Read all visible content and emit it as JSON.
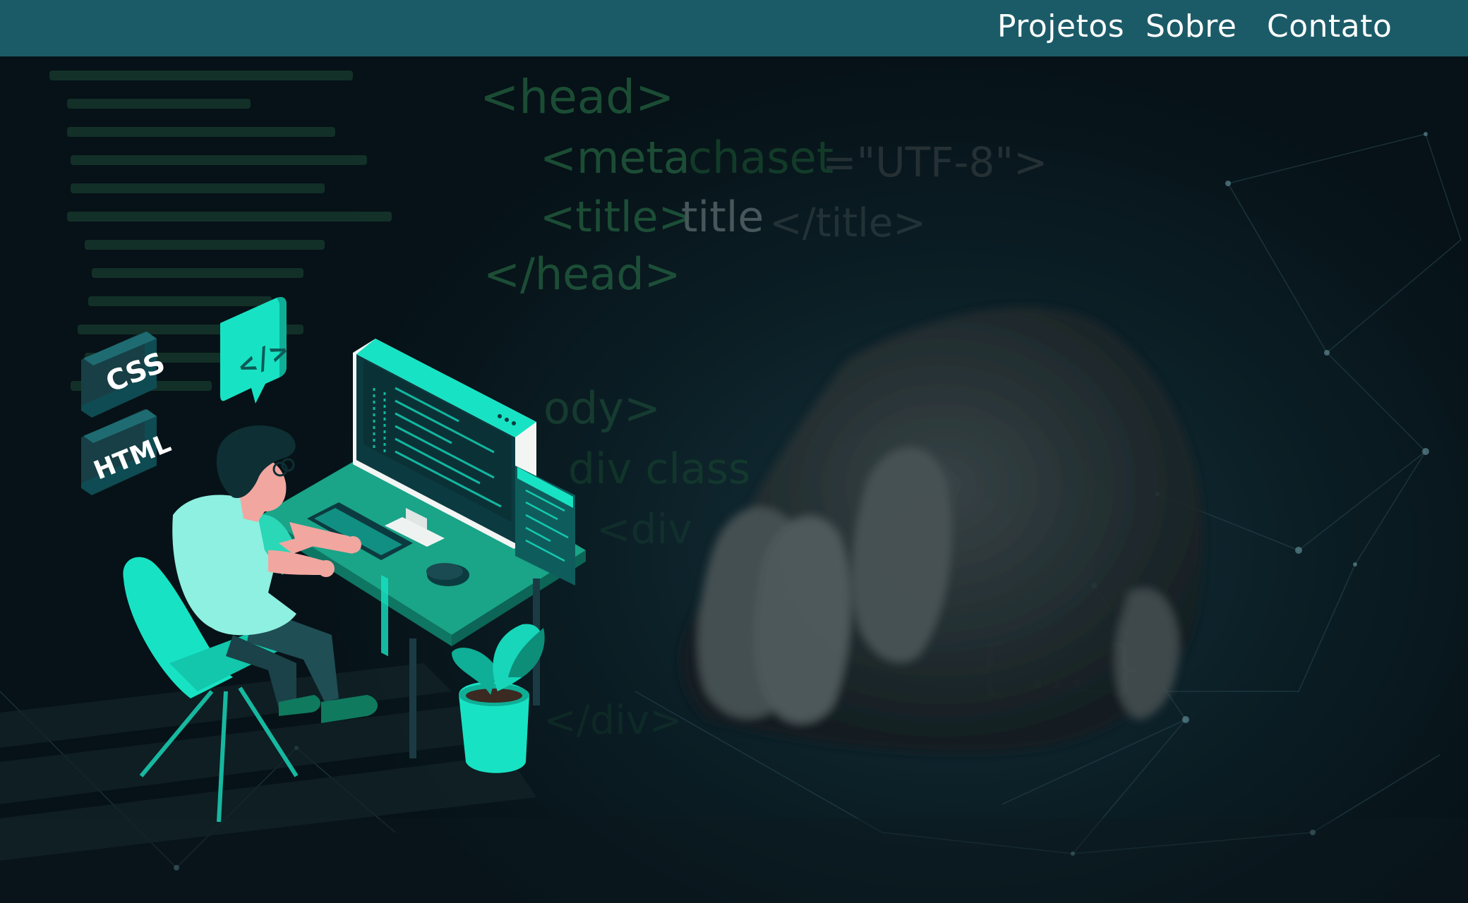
{
  "nav": {
    "links": [
      {
        "label": "Projetos"
      },
      {
        "label": "Sobre"
      },
      {
        "label": "Contato"
      }
    ]
  },
  "hero": {
    "code": {
      "head_open": "<head>",
      "meta_tag": "<meta",
      "meta_attr": "chaset",
      "meta_value": "=\"UTF-8\">",
      "title_open": "<title>",
      "title_text": "title",
      "title_close": "</title>",
      "head_close": "</head>",
      "body_open": "ody>",
      "div_class": "div class",
      "div_open": "<div",
      "close_frag": "</div>",
      "braces": "{ ... }"
    },
    "badges": {
      "css": "CSS",
      "html": "HTML",
      "code": "</>"
    }
  },
  "colors": {
    "nav_bg": "#1b5b67",
    "accent": "#17e3c4",
    "code_green": "#2f7d4e"
  }
}
